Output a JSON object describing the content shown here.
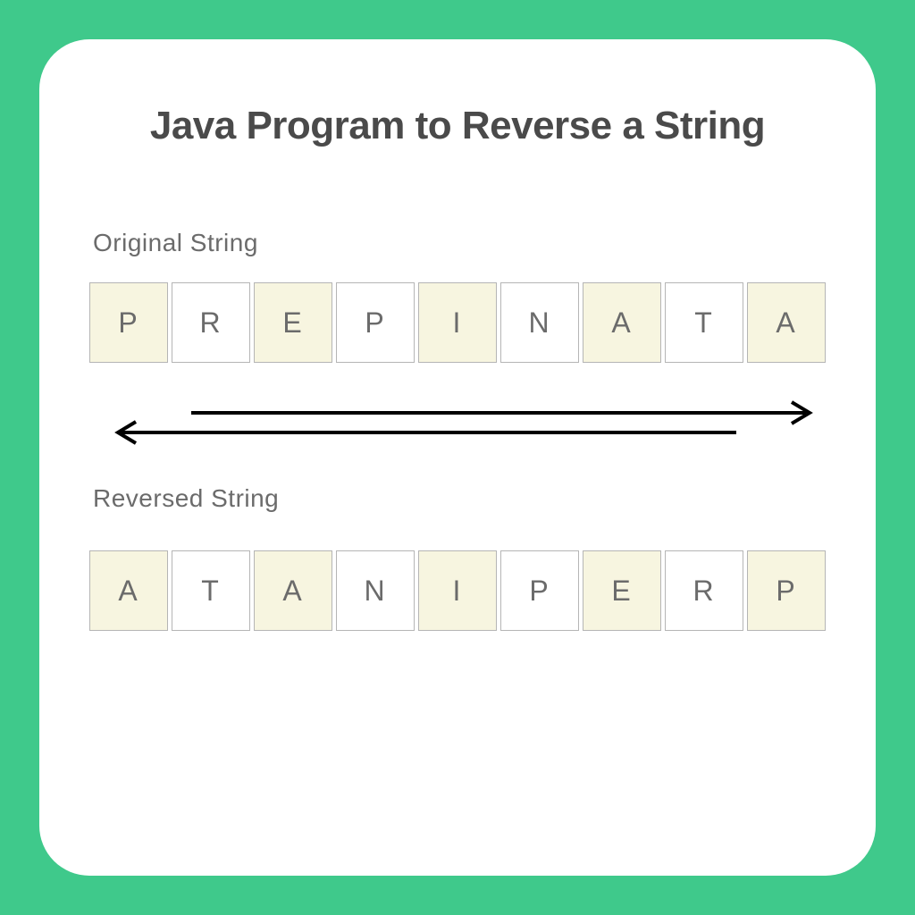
{
  "title": "Java Program to Reverse a String",
  "labels": {
    "original": "Original String",
    "reversed": "Reversed String"
  },
  "original": [
    "P",
    "R",
    "E",
    "P",
    "I",
    "N",
    "A",
    "T",
    "A"
  ],
  "reversed": [
    "A",
    "T",
    "A",
    "N",
    "I",
    "P",
    "E",
    "R",
    "P"
  ],
  "colors": {
    "background": "#3fc98b",
    "cellShaded": "#f7f5e0",
    "cellBorder": "#b5b5b5",
    "text": "#6b6b6b",
    "titleText": "#4a4a4a"
  }
}
